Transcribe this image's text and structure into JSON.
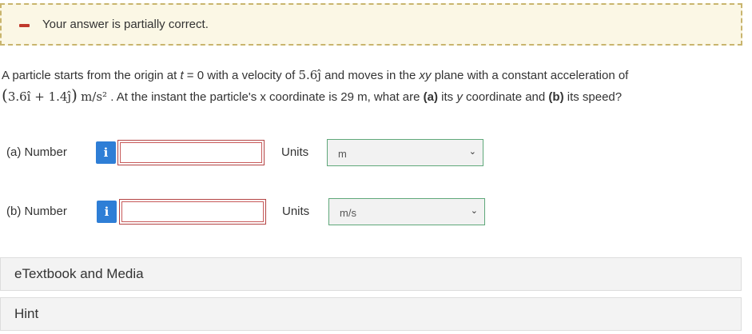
{
  "feedback": {
    "message": "Your answer is partially correct.",
    "status_color": "#c0392b"
  },
  "problem": {
    "text_1": "A particle starts from the origin at ",
    "t_var": "t",
    "text_2": " = 0 with a velocity of ",
    "velocity": "5.6ĵ",
    "text_3": " and moves in the ",
    "plane_var": "xy",
    "text_4": " plane with a constant acceleration of",
    "accel_open": "(",
    "accel_expr": "3.6î + 1.4ĵ",
    "accel_close": ")",
    "accel_unit": "m/s²",
    "text_5": " . At the instant the particle's x coordinate is 29 m, what are ",
    "part_a_tag": "(a)",
    "text_6": " its ",
    "y_var": "y",
    "text_7": " coordinate and ",
    "part_b_tag": "(b)",
    "text_8": " its speed?"
  },
  "parts": [
    {
      "label": "(a)   Number",
      "info_icon": "i",
      "value": "",
      "units_label": "Units",
      "units_value": "m",
      "chevron": "⌄"
    },
    {
      "label": "(b)   Number",
      "info_icon": "i",
      "value": "",
      "units_label": "Units",
      "units_value": "m/s",
      "chevron": "⌄"
    }
  ],
  "resources": {
    "etextbook_label": "eTextbook and Media",
    "hint_label": "Hint"
  }
}
